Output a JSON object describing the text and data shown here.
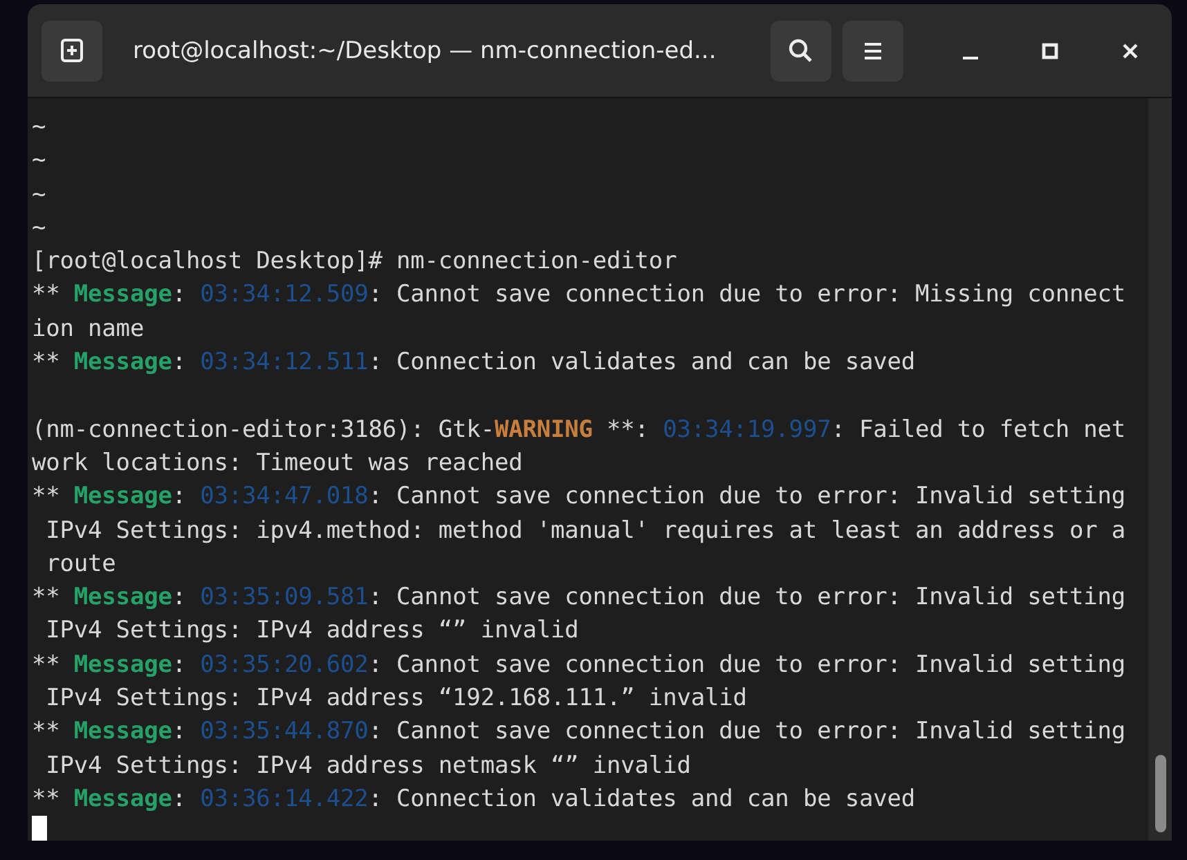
{
  "window": {
    "title": "root@localhost:~/Desktop — nm-connection-ed..."
  },
  "terminal": {
    "lines": [
      [
        {
          "kind": "plain",
          "text": "~"
        }
      ],
      [
        {
          "kind": "plain",
          "text": "~"
        }
      ],
      [
        {
          "kind": "plain",
          "text": "~"
        }
      ],
      [
        {
          "kind": "plain",
          "text": "~"
        }
      ],
      [
        {
          "kind": "plain",
          "text": "[root@localhost Desktop]# nm-connection-editor"
        }
      ],
      [
        {
          "kind": "plain",
          "text": "** "
        },
        {
          "kind": "message",
          "text": "Message"
        },
        {
          "kind": "plain",
          "text": ": "
        },
        {
          "kind": "time",
          "text": "03:34:12.509"
        },
        {
          "kind": "plain",
          "text": ": Cannot save connection due to error: Missing connect"
        }
      ],
      [
        {
          "kind": "plain",
          "text": "ion name"
        }
      ],
      [
        {
          "kind": "plain",
          "text": "** "
        },
        {
          "kind": "message",
          "text": "Message"
        },
        {
          "kind": "plain",
          "text": ": "
        },
        {
          "kind": "time",
          "text": "03:34:12.511"
        },
        {
          "kind": "plain",
          "text": ": Connection validates and can be saved"
        }
      ],
      [
        {
          "kind": "blank_line"
        },
        {
          "kind": "plain",
          "text": "(nm-connection-editor:3186): Gtk-"
        },
        {
          "kind": "warning",
          "text": "WARNING"
        },
        {
          "kind": "plain",
          "text": " **: "
        },
        {
          "kind": "time",
          "text": "03:34:19.997"
        },
        {
          "kind": "plain",
          "text": ": Failed to fetch net"
        }
      ],
      [
        {
          "kind": "plain",
          "text": "work locations: Timeout was reached"
        }
      ],
      [
        {
          "kind": "plain",
          "text": "** "
        },
        {
          "kind": "message",
          "text": "Message"
        },
        {
          "kind": "plain",
          "text": ": "
        },
        {
          "kind": "time",
          "text": "03:34:47.018"
        },
        {
          "kind": "plain",
          "text": ": Cannot save connection due to error: Invalid setting"
        }
      ],
      [
        {
          "kind": "plain",
          "text": " IPv4 Settings: ipv4.method: method 'manual' requires at least an address or a"
        }
      ],
      [
        {
          "kind": "plain",
          "text": " route"
        }
      ],
      [
        {
          "kind": "plain",
          "text": "** "
        },
        {
          "kind": "message",
          "text": "Message"
        },
        {
          "kind": "plain",
          "text": ": "
        },
        {
          "kind": "time",
          "text": "03:35:09.581"
        },
        {
          "kind": "plain",
          "text": ": Cannot save connection due to error: Invalid setting"
        }
      ],
      [
        {
          "kind": "plain",
          "text": " IPv4 Settings: IPv4 address “” invalid"
        }
      ],
      [
        {
          "kind": "plain",
          "text": "** "
        },
        {
          "kind": "message",
          "text": "Message"
        },
        {
          "kind": "plain",
          "text": ": "
        },
        {
          "kind": "time",
          "text": "03:35:20.602"
        },
        {
          "kind": "plain",
          "text": ": Cannot save connection due to error: Invalid setting"
        }
      ],
      [
        {
          "kind": "plain",
          "text": " IPv4 Settings: IPv4 address “192.168.111.” invalid"
        }
      ],
      [
        {
          "kind": "plain",
          "text": "** "
        },
        {
          "kind": "message",
          "text": "Message"
        },
        {
          "kind": "plain",
          "text": ": "
        },
        {
          "kind": "time",
          "text": "03:35:44.870"
        },
        {
          "kind": "plain",
          "text": ": Cannot save connection due to error: Invalid setting"
        }
      ],
      [
        {
          "kind": "plain",
          "text": " IPv4 Settings: IPv4 address netmask “” invalid"
        }
      ],
      [
        {
          "kind": "plain",
          "text": "** "
        },
        {
          "kind": "message",
          "text": "Message"
        },
        {
          "kind": "plain",
          "text": ": "
        },
        {
          "kind": "time",
          "text": "03:36:14.422"
        },
        {
          "kind": "plain",
          "text": ": Connection validates and can be saved"
        }
      ]
    ]
  }
}
